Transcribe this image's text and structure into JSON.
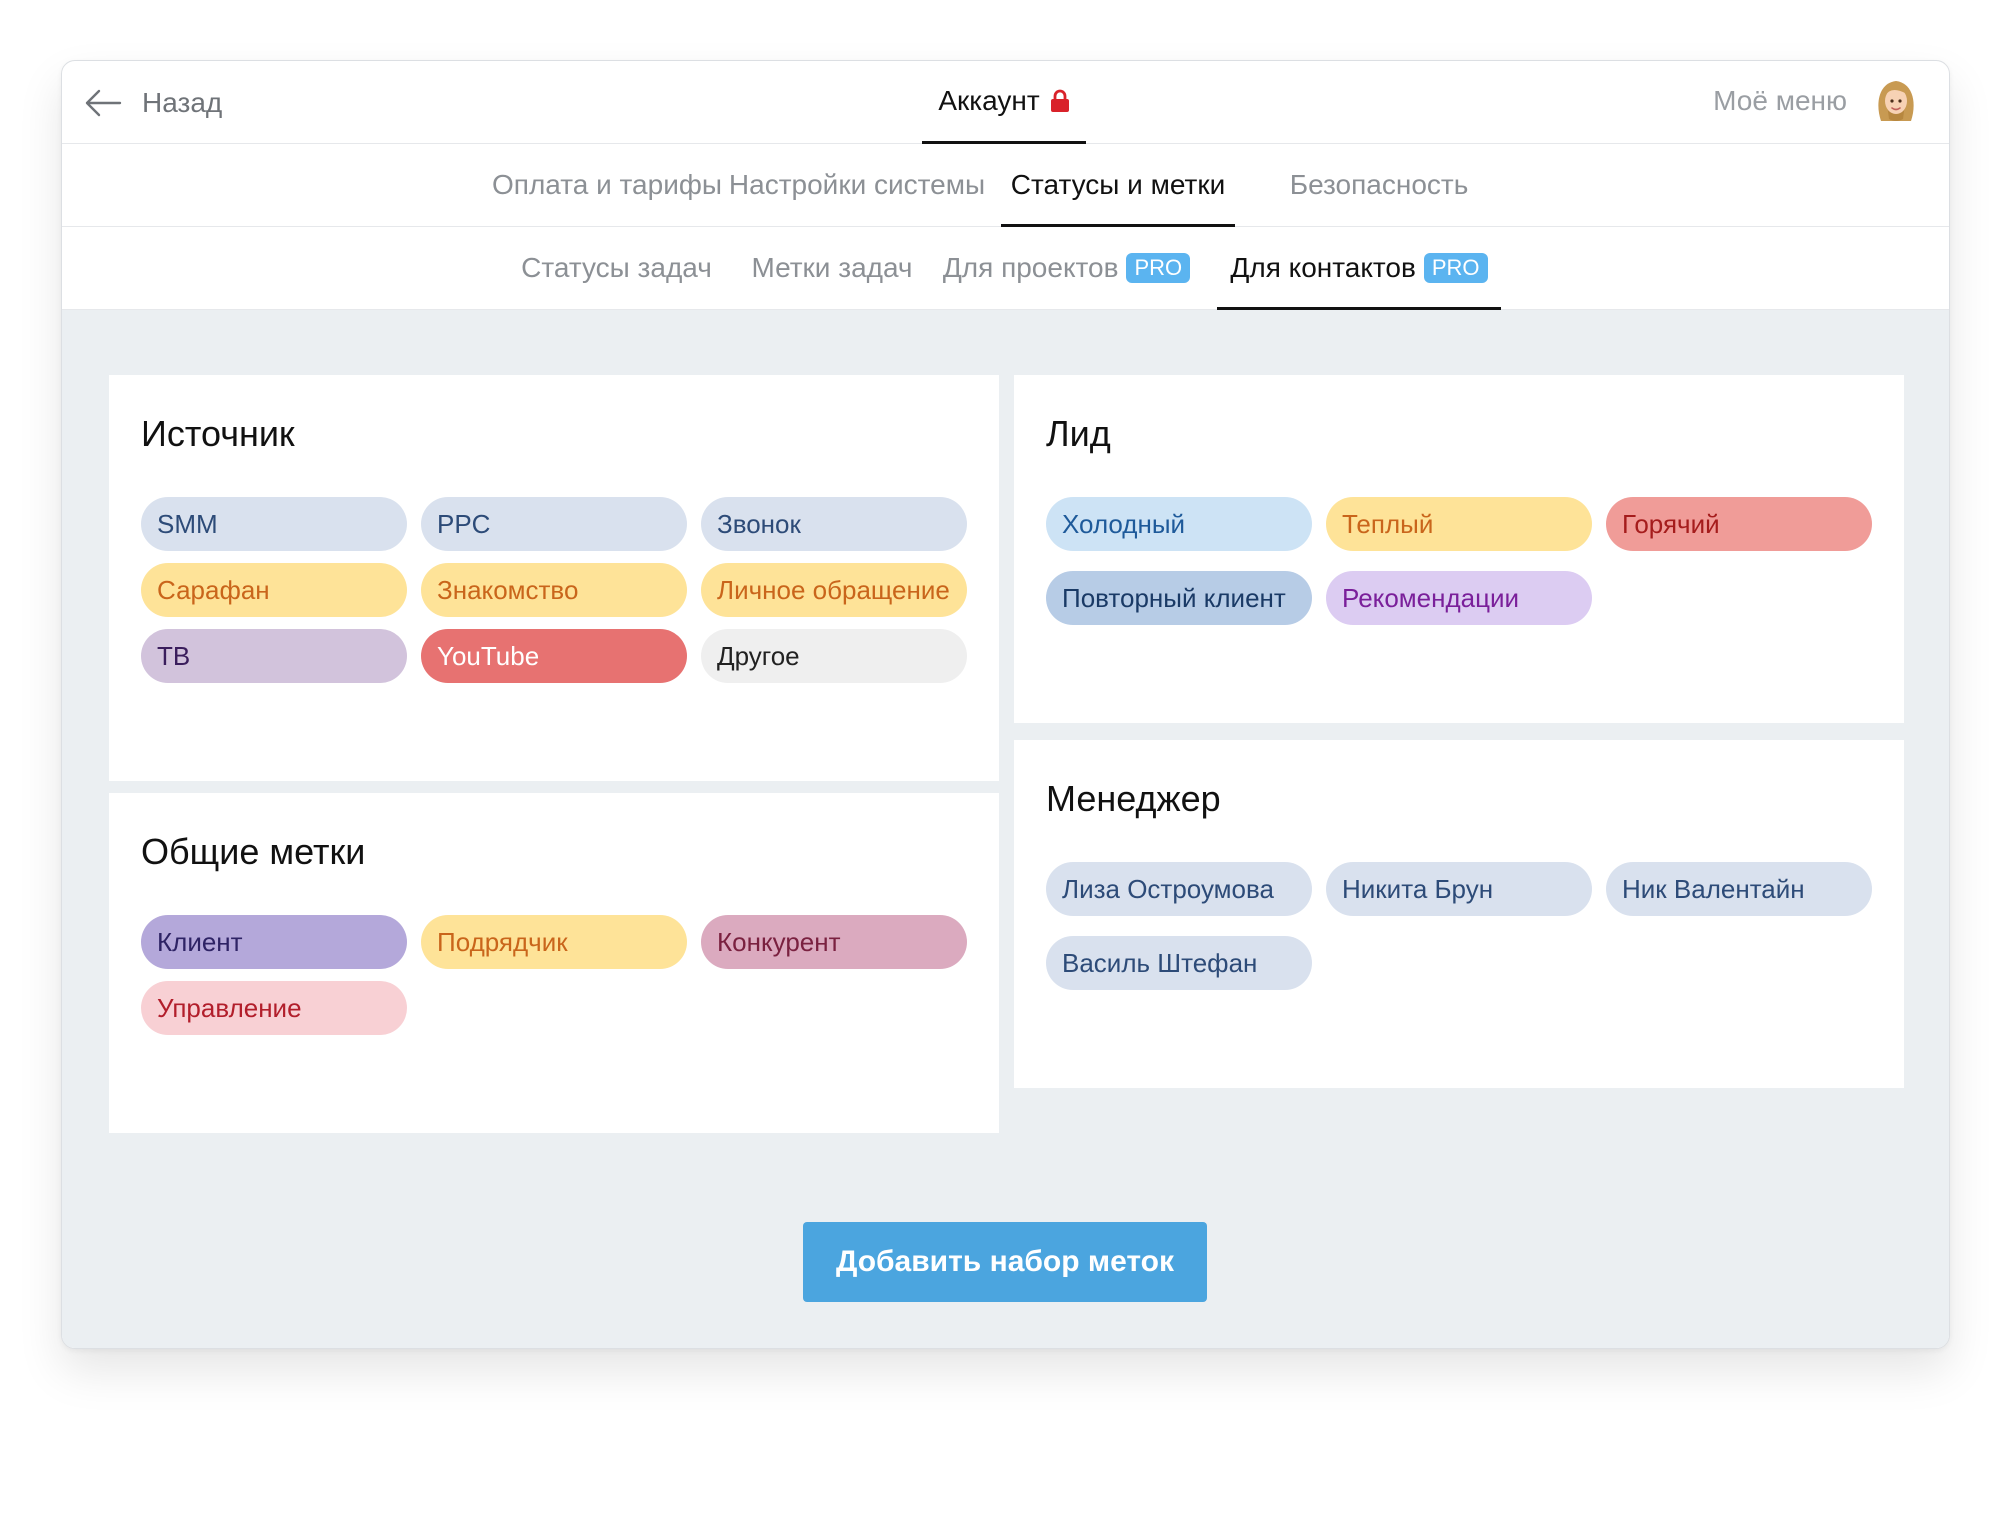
{
  "header": {
    "back_label": "Назад",
    "title": "Аккаунт",
    "my_menu": "Моё меню"
  },
  "main_tabs": [
    {
      "label": "Оплата и тарифы"
    },
    {
      "label": "Настройки системы"
    },
    {
      "label": "Статусы и метки",
      "active": true
    },
    {
      "label": "Безопасность"
    }
  ],
  "sub_tabs": [
    {
      "label": "Статусы задач"
    },
    {
      "label": "Метки задач"
    },
    {
      "label": "Для проектов",
      "badge": "PRO"
    },
    {
      "label": "Для контактов",
      "badge": "PRO",
      "active": true
    }
  ],
  "groups": {
    "source": {
      "title": "Источник",
      "tags": [
        {
          "label": "SMM",
          "bg": "#d9e1ee",
          "color": "#2d4b78"
        },
        {
          "label": "PPC",
          "bg": "#d9e1ee",
          "color": "#2d4b78"
        },
        {
          "label": "Звонок",
          "bg": "#d9e1ee",
          "color": "#2d4b78"
        },
        {
          "label": "Сарафан",
          "bg": "#fee398",
          "color": "#c9651b"
        },
        {
          "label": "Знакомство",
          "bg": "#fee398",
          "color": "#c9651b"
        },
        {
          "label": "Личное обращение",
          "bg": "#fee398",
          "color": "#c9651b"
        },
        {
          "label": "ТВ",
          "bg": "#d2c3dc",
          "color": "#3a1d5c"
        },
        {
          "label": "YouTube",
          "bg": "#e77271",
          "color": "#ffffff"
        },
        {
          "label": "Другое",
          "bg": "#efefef",
          "color": "#222222"
        }
      ]
    },
    "general": {
      "title": "Общие метки",
      "tags": [
        {
          "label": "Клиент",
          "bg": "#b4a8da",
          "color": "#2e2365"
        },
        {
          "label": "Подрядчик",
          "bg": "#fee398",
          "color": "#c9651b"
        },
        {
          "label": "Конкурент",
          "bg": "#dbaabf",
          "color": "#7a2140"
        },
        {
          "label": "Управление",
          "bg": "#f8d0d4",
          "color": "#b21e2b"
        }
      ]
    },
    "lead": {
      "title": "Лид",
      "tags": [
        {
          "label": "Холодный",
          "bg": "#cde3f5",
          "color": "#1e5a9a"
        },
        {
          "label": "Теплый",
          "bg": "#fee398",
          "color": "#c9651b"
        },
        {
          "label": "Горячий",
          "bg": "#f09c98",
          "color": "#a51c1c"
        },
        {
          "label": "Повторный клиент",
          "bg": "#b7cce6",
          "color": "#1a3a66"
        },
        {
          "label": "Рекомендации",
          "bg": "#dcccf2",
          "color": "#7a1f9a"
        }
      ]
    },
    "manager": {
      "title": "Менеджер",
      "tags": [
        {
          "label": "Лиза Остроумова",
          "bg": "#d9e1ee",
          "color": "#2d4b78"
        },
        {
          "label": "Никита Брун",
          "bg": "#d9e1ee",
          "color": "#2d4b78"
        },
        {
          "label": "Ник  Валентайн",
          "bg": "#d9e1ee",
          "color": "#2d4b78"
        },
        {
          "label": "Василь Штефан",
          "bg": "#d9e1ee",
          "color": "#2d4b78"
        }
      ]
    }
  },
  "add_button": "Добавить набор меток",
  "colors": {
    "accent_blue": "#4ba5df",
    "pro_badge": "#5bb4f0",
    "lock": "#d9222a",
    "content_bg": "#ebeff2"
  },
  "icons": {
    "back": "arrow-left-icon",
    "lock": "lock-icon",
    "avatar": "avatar"
  }
}
